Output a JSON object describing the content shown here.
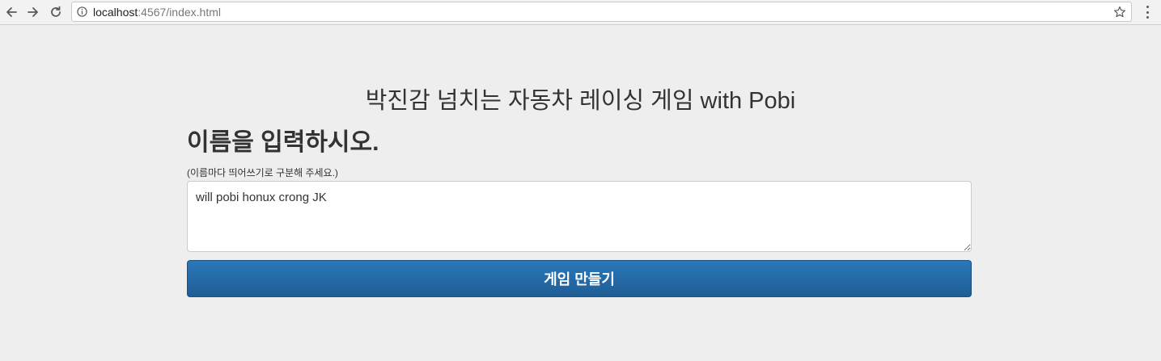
{
  "browser": {
    "url_host": "localhost",
    "url_path": ":4567/index.html"
  },
  "page": {
    "title": "박진감 넘치는 자동차 레이싱 게임 with Pobi",
    "heading": "이름을 입력하시오.",
    "hint": "(이름마다 띄어쓰기로 구분해 주세요.)"
  },
  "form": {
    "names_value": "will pobi honux crong JK",
    "submit_label": "게임 만들기"
  },
  "colors": {
    "button_primary": "#2466a6",
    "page_background": "#eeeeee"
  }
}
